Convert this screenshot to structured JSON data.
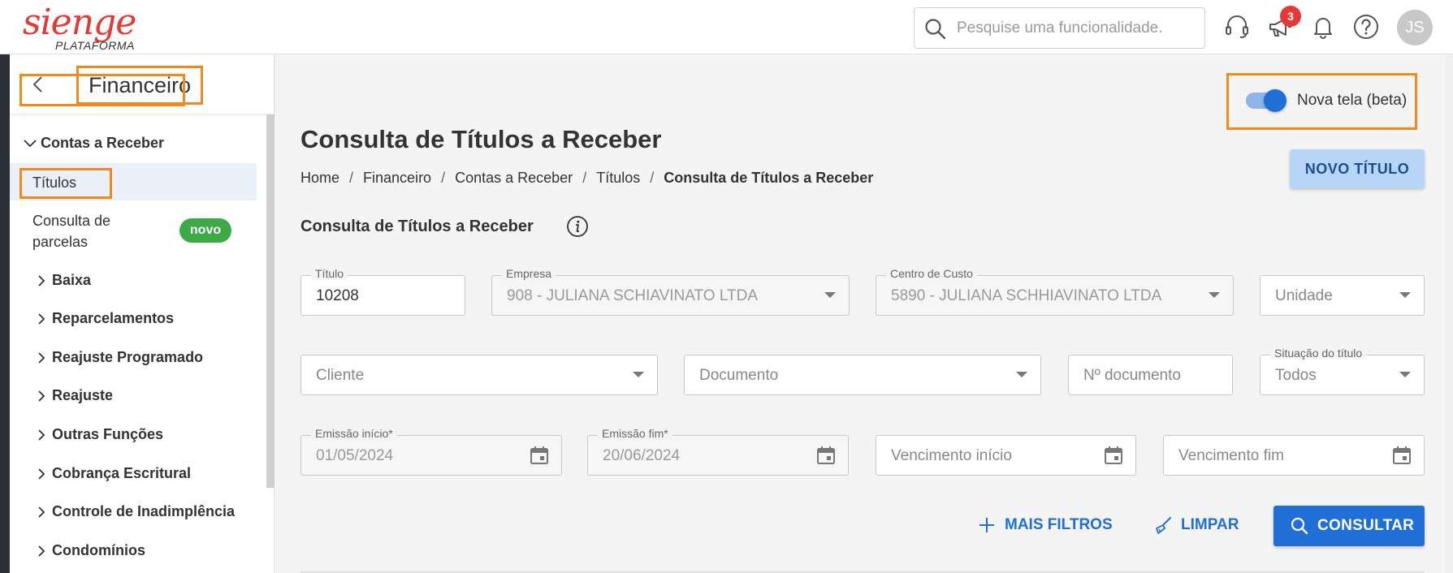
{
  "header": {
    "logo_main": "sienge",
    "logo_sub": "PLATAFORMA",
    "search_placeholder": "Pesquise uma funcionalidade.",
    "notifications_count": "3",
    "avatar_initials": "JS"
  },
  "sidebar": {
    "title": "Financeiro",
    "group": "Contas a Receber",
    "active_item": "Títulos",
    "consulta_item": "Consulta de parcelas",
    "consulta_badge": "novo",
    "items": [
      "Baixa",
      "Reparcelamentos",
      "Reajuste Programado",
      "Reajuste",
      "Outras Funções",
      "Cobrança Escritural",
      "Controle de Inadimplência",
      "Condomínios"
    ]
  },
  "main": {
    "toggle_label": "Nova tela (beta)",
    "page_title": "Consulta de Títulos a Receber",
    "breadcrumb": [
      "Home",
      "Financeiro",
      "Contas a Receber",
      "Títulos",
      "Consulta de Títulos a Receber"
    ],
    "new_button": "NOVO TÍTULO",
    "section_title": "Consulta de Títulos a Receber",
    "fields": {
      "titulo": {
        "label": "Título",
        "value": "10208"
      },
      "empresa": {
        "label": "Empresa",
        "value": "908 - JULIANA SCHIAVINATO LTDA"
      },
      "centro_custo": {
        "label": "Centro de Custo",
        "value": "5890 - JULIANA SCHHIAVINATO LTDA"
      },
      "unidade": {
        "placeholder": "Unidade"
      },
      "cliente": {
        "placeholder": "Cliente"
      },
      "documento": {
        "placeholder": "Documento"
      },
      "n_documento": {
        "placeholder": "Nº documento"
      },
      "situacao": {
        "label": "Situação do título",
        "value": "Todos"
      },
      "emissao_inicio": {
        "label": "Emissão início*",
        "value": "01/05/2024"
      },
      "emissao_fim": {
        "label": "Emissão fim*",
        "value": "20/06/2024"
      },
      "vencimento_inicio": {
        "placeholder": "Vencimento início"
      },
      "vencimento_fim": {
        "placeholder": "Vencimento fim"
      }
    },
    "actions": {
      "mais_filtros": "MAIS FILTROS",
      "limpar": "LIMPAR",
      "consultar": "CONSULTAR"
    }
  },
  "colors": {
    "accent": "#1f6fd6",
    "highlight_border": "#f08a1c",
    "badge_red": "#e53935",
    "novo_green": "#3daa46",
    "logo_red": "#e53935"
  },
  "icons": [
    "search-icon",
    "headset-icon",
    "megaphone-icon",
    "bell-icon",
    "help-icon",
    "back-chevron-icon",
    "chevron-down-icon",
    "chevron-right-icon",
    "info-icon",
    "calendar-icon",
    "plus-icon",
    "broom-icon"
  ]
}
